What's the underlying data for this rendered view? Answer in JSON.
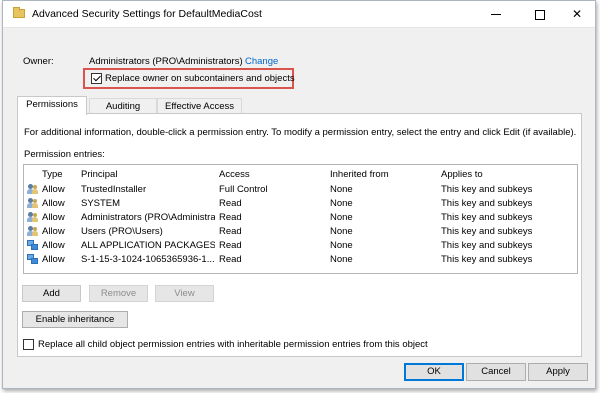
{
  "window": {
    "title": "Advanced Security Settings for DefaultMediaCost",
    "title_icon": "folder-icon",
    "controls": [
      "minimize-icon",
      "maximize-icon",
      "close-icon"
    ],
    "close_glyph": "✕"
  },
  "owner": {
    "label": "Owner:",
    "value": "Administrators (PRO\\Administrators)",
    "change_link": "Change"
  },
  "replace_owner": {
    "label": "Replace owner on subcontainers and objects",
    "checked": true,
    "highlight_color": "#d9534f"
  },
  "tabs": [
    {
      "label": "Permissions",
      "active": true
    },
    {
      "label": "Auditing",
      "active": false
    },
    {
      "label": "Effective Access",
      "active": false
    }
  ],
  "permissions": {
    "info": "For additional information, double-click a permission entry. To modify a permission entry, select the entry and click Edit (if available).",
    "entries_label": "Permission entries:",
    "columns": {
      "type": "Type",
      "principal": "Principal",
      "access": "Access",
      "inherited": "Inherited from",
      "applies": "Applies to"
    },
    "rows": [
      {
        "icon": "user-group-icon",
        "type": "Allow",
        "principal": "TrustedInstaller",
        "access": "Full Control",
        "inherited": "None",
        "applies": "This key and subkeys"
      },
      {
        "icon": "user-group-icon",
        "type": "Allow",
        "principal": "SYSTEM",
        "access": "Read",
        "inherited": "None",
        "applies": "This key and subkeys"
      },
      {
        "icon": "user-group-icon",
        "type": "Allow",
        "principal": "Administrators (PRO\\Administrat...",
        "access": "Read",
        "inherited": "None",
        "applies": "This key and subkeys"
      },
      {
        "icon": "user-group-icon",
        "type": "Allow",
        "principal": "Users (PRO\\Users)",
        "access": "Read",
        "inherited": "None",
        "applies": "This key and subkeys"
      },
      {
        "icon": "app-package-icon",
        "type": "Allow",
        "principal": "ALL APPLICATION PACKAGES",
        "access": "Read",
        "inherited": "None",
        "applies": "This key and subkeys"
      },
      {
        "icon": "app-package-icon",
        "type": "Allow",
        "principal": "S-1-15-3-1024-1065365936-1...",
        "access": "Read",
        "inherited": "None",
        "applies": "This key and subkeys"
      }
    ],
    "buttons": {
      "add": "Add",
      "remove": "Remove",
      "view": "View",
      "enable_inheritance": "Enable inheritance"
    },
    "replace_child": {
      "label": "Replace all child object permission entries with inheritable permission entries from this object",
      "checked": false
    }
  },
  "footer": {
    "ok": "OK",
    "cancel": "Cancel",
    "apply": "Apply"
  }
}
